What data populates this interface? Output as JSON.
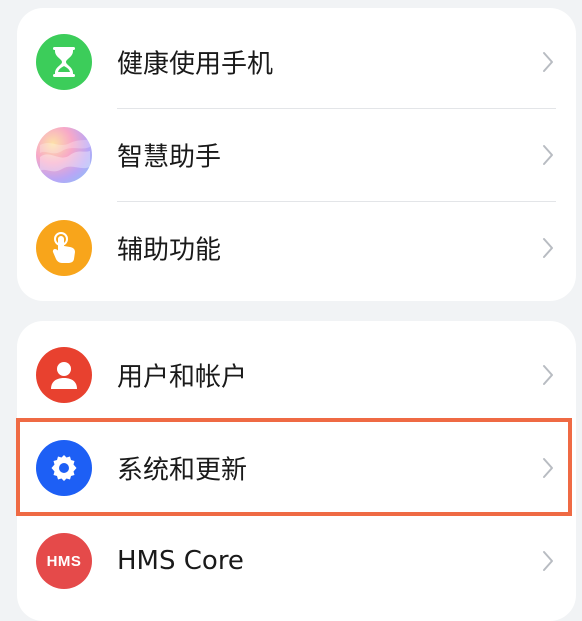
{
  "sections": [
    {
      "items": [
        {
          "label": "健康使用手机",
          "icon": "hourglass-icon",
          "color": "#3ccd5a"
        },
        {
          "label": "智慧助手",
          "icon": "celia-assistant-icon",
          "color": "#c7a8f5"
        },
        {
          "label": "辅助功能",
          "icon": "hand-tap-icon",
          "color": "#f8a51b"
        }
      ]
    },
    {
      "items": [
        {
          "label": "用户和帐户",
          "icon": "user-icon",
          "color": "#e8412f"
        },
        {
          "label": "系统和更新",
          "icon": "gear-icon",
          "color": "#1d5ff5",
          "highlighted": true
        },
        {
          "label": "HMS Core",
          "icon": "hms-icon",
          "icon_text": "HMS",
          "color": "#e54a4a"
        }
      ]
    }
  ],
  "highlight_color": "#ef6a44"
}
